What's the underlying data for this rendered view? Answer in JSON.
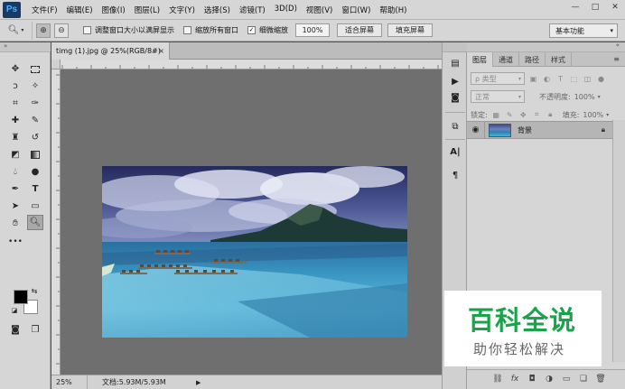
{
  "app": {
    "logo": "Ps"
  },
  "menu": [
    "文件(F)",
    "编辑(E)",
    "图像(I)",
    "图层(L)",
    "文字(Y)",
    "选择(S)",
    "滤镜(T)",
    "3D(D)",
    "视图(V)",
    "窗口(W)",
    "帮助(H)"
  ],
  "window_controls": {
    "minimize": "—",
    "maximize": "□",
    "close": "✕"
  },
  "options": {
    "tool_icon": "zoom-tool-icon",
    "zoom_in": "⊕",
    "zoom_out": "⊖",
    "resize_windows_label": "调整窗口大小以满屏显示",
    "resize_windows_checked": false,
    "zoom_all_label": "缩放所有窗口",
    "zoom_all_checked": false,
    "scrubby_label": "细微缩放",
    "scrubby_checked": true,
    "zoom_value": "100%",
    "fit_screen": "适合屏幕",
    "fill_screen": "填充屏幕",
    "workspace": "基本功能"
  },
  "document": {
    "tab_title": "timg (1).jpg @ 25%(RGB/8#)",
    "tab_close": "×",
    "status_zoom": "25%",
    "status_info": "文档:5.93M/5.93M",
    "status_arrow": "▶"
  },
  "layers_panel": {
    "tabs": [
      "图层",
      "通道",
      "路径",
      "样式"
    ],
    "active_tab": 0,
    "filter_label": "ρ 类型",
    "blend_mode": "正常",
    "opacity_label": "不透明度:",
    "opacity_value": "100%",
    "lock_label": "锁定:",
    "fill_label": "填充:",
    "fill_value": "100%",
    "layer_name": "背景",
    "footer_icons": [
      "link",
      "fx",
      "mask",
      "adjust",
      "group",
      "new",
      "delete"
    ]
  },
  "watermark": {
    "main": "百科全说",
    "sub": "助你轻松解决"
  },
  "colors": {
    "chrome": "#d6d6d6",
    "canvas_bg": "#6e6e6e",
    "workspace_bg": "#535353",
    "watermark_green": "#1aa34a"
  }
}
